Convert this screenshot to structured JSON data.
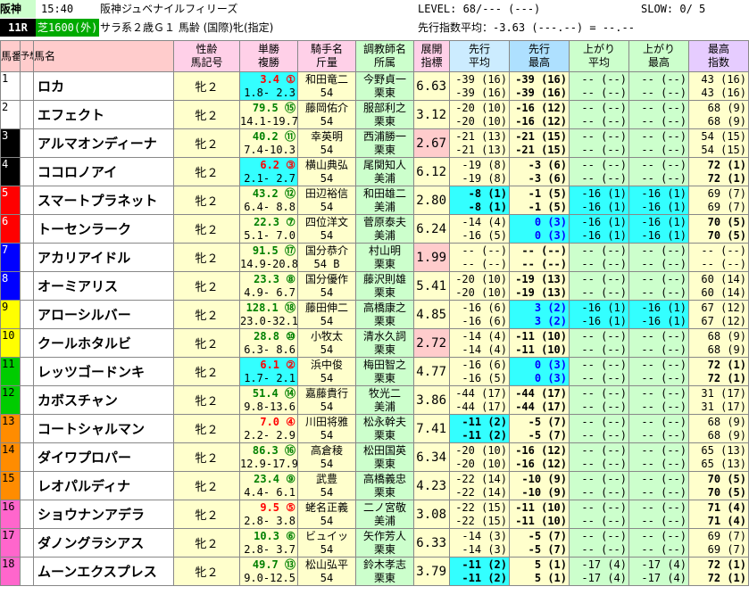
{
  "header": {
    "venue": "阪神",
    "time": "15:40",
    "race_name": "阪神ジュベナイルフィリーズ",
    "level": "LEVEL: 68/--- (---)",
    "slow": "SLOW: 0/ 5",
    "race_no": "11R",
    "course": "芝1600(外)",
    "conditions": "サラ系２歳Ｇ１ 馬齢 (国際)牝(指定)",
    "avg_label": "先行指数平均：-3.63 (---.--) = --.--"
  },
  "columns": {
    "umaban": "馬番",
    "yoso": "予想",
    "name": "馬名",
    "sex_age": "性齢",
    "sex_age2": "馬記号",
    "tan": "単勝",
    "fuku": "複勝",
    "jockey": "騎手名",
    "weight": "斤量",
    "trainer": "調教師名",
    "belong": "所属",
    "tenkai": "展開",
    "tenkai2": "指標",
    "senko": "先行",
    "senko2": "平均",
    "senkom": "先行",
    "senkom2": "最高",
    "agari": "上がり",
    "agari2": "平均",
    "agarim": "上がり",
    "agarim2": "最高",
    "max": "最高",
    "max2": "指数"
  },
  "rows": [
    {
      "no": "1",
      "name": "ロカ",
      "sex": "牝２",
      "tan": "3.4 ①",
      "fuku": "1.8- 2.3",
      "jockey": "和田竜二",
      "kin": "54",
      "trainer": "今野貞一",
      "belong": "栗東",
      "ten": "6.63",
      "sp1": "-39 (16)",
      "sp2": "-39 (16)",
      "sm1": "-39 (16)",
      "sm2": "-39 (16)",
      "ag1": "-- (--)",
      "ag2": "-- (--)",
      "am1": "-- (--)",
      "am2": "-- (--)",
      "mx1": "43 (16)",
      "mx2": "43 (16)"
    },
    {
      "no": "2",
      "name": "エフェクト",
      "sex": "牝２",
      "tan": "79.5 ⑮",
      "fuku": "14.1-19.7",
      "jockey": "藤岡佑介",
      "kin": "54",
      "trainer": "服部利之",
      "belong": "栗東",
      "ten": "3.12",
      "sp1": "-20 (10)",
      "sp2": "-20 (10)",
      "sm1": "-16 (12)",
      "sm2": "-16 (12)",
      "ag1": "-- (--)",
      "ag2": "-- (--)",
      "am1": "-- (--)",
      "am2": "-- (--)",
      "mx1": "68 (9)",
      "mx2": "68 (9)"
    },
    {
      "no": "3",
      "name": "アルマオンディーナ",
      "sex": "牝２",
      "tan": "40.2 ⑪",
      "fuku": "7.4-10.3",
      "jockey": "幸英明",
      "kin": "54",
      "trainer": "西浦勝一",
      "belong": "栗東",
      "ten": "2.67",
      "sp1": "-21 (13)",
      "sp2": "-21 (13)",
      "sm1": "-21 (15)",
      "sm2": "-21 (15)",
      "ag1": "-- (--)",
      "ag2": "-- (--)",
      "am1": "-- (--)",
      "am2": "-- (--)",
      "mx1": "54 (15)",
      "mx2": "54 (15)"
    },
    {
      "no": "4",
      "name": "ココロノアイ",
      "sex": "牝２",
      "tan": "6.2 ③",
      "fuku": "2.1- 2.7",
      "jockey": "横山典弘",
      "kin": "54",
      "trainer": "尾関知人",
      "belong": "美浦",
      "ten": "6.12",
      "sp1": "-19 (8)",
      "sp2": "-19 (8)",
      "sm1": "-3 (6)",
      "sm2": "-3 (6)",
      "ag1": "-- (--)",
      "ag2": "-- (--)",
      "am1": "-- (--)",
      "am2": "-- (--)",
      "mx1": "72 (1)",
      "mx2": "72 (1)"
    },
    {
      "no": "5",
      "name": "スマートプラネット",
      "sex": "牝２",
      "tan": "43.2 ⑫",
      "fuku": "6.4- 8.8",
      "jockey": "田辺裕信",
      "kin": "54",
      "trainer": "和田雄二",
      "belong": "美浦",
      "ten": "2.80",
      "sp1": "-8 (1)",
      "sp2": "-8 (1)",
      "sm1": "-1 (5)",
      "sm2": "-1 (5)",
      "ag1": "-16 (1)",
      "ag2": "-16 (1)",
      "am1": "-16 (1)",
      "am2": "-16 (1)",
      "mx1": "69 (7)",
      "mx2": "69 (7)"
    },
    {
      "no": "6",
      "name": "トーセンラーク",
      "sex": "牝２",
      "tan": "22.3 ⑦",
      "fuku": "5.1- 7.0",
      "jockey": "四位洋文",
      "kin": "54",
      "trainer": "菅原泰夫",
      "belong": "美浦",
      "ten": "6.24",
      "sp1": "-14 (4)",
      "sp2": "-16 (5)",
      "sm1": "0 (3)",
      "sm2": "0 (3)",
      "ag1": "-16 (1)",
      "ag2": "-16 (1)",
      "am1": "-16 (1)",
      "am2": "-16 (1)",
      "mx1": "70 (5)",
      "mx2": "70 (5)"
    },
    {
      "no": "7",
      "name": "アカリアイドル",
      "sex": "牝２",
      "tan": "91.5 ⑰",
      "fuku": "14.9-20.8",
      "jockey": "国分恭介",
      "kin": "54 B",
      "trainer": "村山明",
      "belong": "栗東",
      "ten": "1.99",
      "sp1": "-- (--)",
      "sp2": "-- (--)",
      "sm1": "-- (--)",
      "sm2": "-- (--)",
      "ag1": "-- (--)",
      "ag2": "-- (--)",
      "am1": "-- (--)",
      "am2": "-- (--)",
      "mx1": "-- (--)",
      "mx2": "-- (--)"
    },
    {
      "no": "8",
      "name": "オーミアリス",
      "sex": "牝２",
      "tan": "23.3 ⑧",
      "fuku": "4.9- 6.7",
      "jockey": "国分優作",
      "kin": "54",
      "trainer": "藤沢則雄",
      "belong": "栗東",
      "ten": "5.41",
      "sp1": "-20 (10)",
      "sp2": "-20 (10)",
      "sm1": "-19 (13)",
      "sm2": "-19 (13)",
      "ag1": "-- (--)",
      "ag2": "-- (--)",
      "am1": "-- (--)",
      "am2": "-- (--)",
      "mx1": "60 (14)",
      "mx2": "60 (14)"
    },
    {
      "no": "9",
      "name": "アローシルバー",
      "sex": "牝２",
      "tan": "128.1 ⑱",
      "fuku": "23.0-32.1",
      "jockey": "藤田伸二",
      "kin": "54",
      "trainer": "高橋康之",
      "belong": "栗東",
      "ten": "4.85",
      "sp1": "-16 (6)",
      "sp2": "-16 (6)",
      "sm1": "3 (2)",
      "sm2": "3 (2)",
      "ag1": "-16 (1)",
      "ag2": "-16 (1)",
      "am1": "-16 (1)",
      "am2": "-16 (1)",
      "mx1": "67 (12)",
      "mx2": "67 (12)"
    },
    {
      "no": "10",
      "name": "クールホタルビ",
      "sex": "牝２",
      "tan": "28.8 ⑩",
      "fuku": "6.3- 8.6",
      "jockey": "小牧太",
      "kin": "54",
      "trainer": "清水久詞",
      "belong": "栗東",
      "ten": "2.72",
      "sp1": "-14 (4)",
      "sp2": "-14 (4)",
      "sm1": "-11 (10)",
      "sm2": "-11 (10)",
      "ag1": "-- (--)",
      "ag2": "-- (--)",
      "am1": "-- (--)",
      "am2": "-- (--)",
      "mx1": "68 (9)",
      "mx2": "68 (9)"
    },
    {
      "no": "11",
      "name": "レッツゴードンキ",
      "sex": "牝２",
      "tan": "6.1 ②",
      "fuku": "1.7- 2.1",
      "jockey": "浜中俊",
      "kin": "54",
      "trainer": "梅田智之",
      "belong": "栗東",
      "ten": "4.77",
      "sp1": "-16 (6)",
      "sp2": "-16 (5)",
      "sm1": "0 (3)",
      "sm2": "0 (3)",
      "ag1": "-- (--)",
      "ag2": "-- (--)",
      "am1": "-- (--)",
      "am2": "-- (--)",
      "mx1": "72 (1)",
      "mx2": "72 (1)"
    },
    {
      "no": "12",
      "name": "カボスチャン",
      "sex": "牝２",
      "tan": "51.4 ⑭",
      "fuku": "9.8-13.6",
      "jockey": "嘉藤貴行",
      "kin": "54",
      "trainer": "牧光二",
      "belong": "美浦",
      "ten": "3.86",
      "sp1": "-44 (17)",
      "sp2": "-44 (17)",
      "sm1": "-44 (17)",
      "sm2": "-44 (17)",
      "ag1": "-- (--)",
      "ag2": "-- (--)",
      "am1": "-- (--)",
      "am2": "-- (--)",
      "mx1": "31 (17)",
      "mx2": "31 (17)"
    },
    {
      "no": "13",
      "name": "コートシャルマン",
      "sex": "牝２",
      "tan": "7.0 ④",
      "fuku": "2.2- 2.9",
      "jockey": "川田将雅",
      "kin": "54",
      "trainer": "松永幹夫",
      "belong": "栗東",
      "ten": "7.41",
      "sp1": "-11 (2)",
      "sp2": "-11 (2)",
      "sm1": "-5 (7)",
      "sm2": "-5 (7)",
      "ag1": "-- (--)",
      "ag2": "-- (--)",
      "am1": "-- (--)",
      "am2": "-- (--)",
      "mx1": "68 (9)",
      "mx2": "68 (9)"
    },
    {
      "no": "14",
      "name": "ダイワプロパー",
      "sex": "牝２",
      "tan": "86.3 ⑯",
      "fuku": "12.9-17.9",
      "jockey": "高倉稜",
      "kin": "54",
      "trainer": "松田国英",
      "belong": "栗東",
      "ten": "6.34",
      "sp1": "-20 (10)",
      "sp2": "-20 (10)",
      "sm1": "-16 (12)",
      "sm2": "-16 (12)",
      "ag1": "-- (--)",
      "ag2": "-- (--)",
      "am1": "-- (--)",
      "am2": "-- (--)",
      "mx1": "65 (13)",
      "mx2": "65 (13)"
    },
    {
      "no": "15",
      "name": "レオパルディナ",
      "sex": "牝２",
      "tan": "23.4 ⑨",
      "fuku": "4.4- 6.1",
      "jockey": "武豊",
      "kin": "54",
      "trainer": "高橋義忠",
      "belong": "栗東",
      "ten": "4.23",
      "sp1": "-22 (14)",
      "sp2": "-22 (14)",
      "sm1": "-10 (9)",
      "sm2": "-10 (9)",
      "ag1": "-- (--)",
      "ag2": "-- (--)",
      "am1": "-- (--)",
      "am2": "-- (--)",
      "mx1": "70 (5)",
      "mx2": "70 (5)"
    },
    {
      "no": "16",
      "name": "ショウナンアデラ",
      "sex": "牝２",
      "tan": "9.5 ⑤",
      "fuku": "2.8- 3.8",
      "jockey": "蛯名正義",
      "kin": "54",
      "trainer": "二ノ宮敬",
      "belong": "美浦",
      "ten": "3.08",
      "sp1": "-22 (15)",
      "sp2": "-22 (15)",
      "sm1": "-11 (10)",
      "sm2": "-11 (10)",
      "ag1": "-- (--)",
      "ag2": "-- (--)",
      "am1": "-- (--)",
      "am2": "-- (--)",
      "mx1": "71 (4)",
      "mx2": "71 (4)"
    },
    {
      "no": "17",
      "name": "ダノングラシアス",
      "sex": "牝２",
      "tan": "10.3 ⑥",
      "fuku": "2.8- 3.7",
      "jockey": "ビュイッ",
      "kin": "54",
      "trainer": "矢作芳人",
      "belong": "栗東",
      "ten": "6.33",
      "sp1": "-14 (3)",
      "sp2": "-14 (3)",
      "sm1": "-5 (7)",
      "sm2": "-5 (7)",
      "ag1": "-- (--)",
      "ag2": "-- (--)",
      "am1": "-- (--)",
      "am2": "-- (--)",
      "mx1": "69 (7)",
      "mx2": "69 (7)"
    },
    {
      "no": "18",
      "name": "ムーンエクスプレス",
      "sex": "牝２",
      "tan": "49.7 ⑬",
      "fuku": "9.0-12.5",
      "jockey": "松山弘平",
      "kin": "54",
      "trainer": "鈴木孝志",
      "belong": "栗東",
      "ten": "3.79",
      "sp1": "-11 (2)",
      "sp2": "-11 (2)",
      "sm1": "5 (1)",
      "sm2": "5 (1)",
      "ag1": "-17 (4)",
      "ag2": "-17 (4)",
      "am1": "-17 (4)",
      "am2": "-17 (4)",
      "mx1": "72 (1)",
      "mx2": "72 (1)"
    }
  ],
  "frame_colors": [
    "#ffffff",
    "#ffffff",
    "#000000",
    "#000000",
    "#ff0000",
    "#ff0000",
    "#0000ff",
    "#0000ff",
    "#ffff00",
    "#ffff00",
    "#00cc00",
    "#00cc00",
    "#ff8c00",
    "#ff8c00",
    "#ff8c00",
    "#ff66cc",
    "#ff66cc",
    "#ff66cc"
  ]
}
